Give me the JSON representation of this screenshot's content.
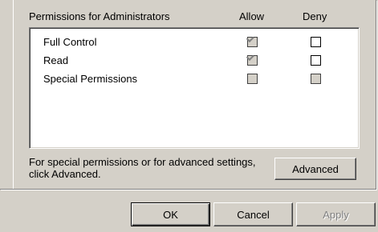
{
  "header": {
    "permissions_label": "Permissions for Administrators",
    "allow_label": "Allow",
    "deny_label": "Deny"
  },
  "permissions": [
    {
      "name": "Full Control",
      "allow": true,
      "allow_disabled": true,
      "deny": false,
      "deny_disabled": false
    },
    {
      "name": "Read",
      "allow": true,
      "allow_disabled": true,
      "deny": false,
      "deny_disabled": false
    },
    {
      "name": "Special Permissions",
      "allow": false,
      "allow_disabled": true,
      "deny": false,
      "deny_disabled": true
    }
  ],
  "hint": {
    "text": "For special permissions or for advanced settings, click Advanced."
  },
  "buttons": {
    "advanced": "Advanced",
    "ok": "OK",
    "cancel": "Cancel",
    "apply": "Apply"
  },
  "colors": {
    "dialog_bg": "#d4d0c8",
    "list_bg": "#ffffff",
    "disabled_text": "#808080"
  }
}
